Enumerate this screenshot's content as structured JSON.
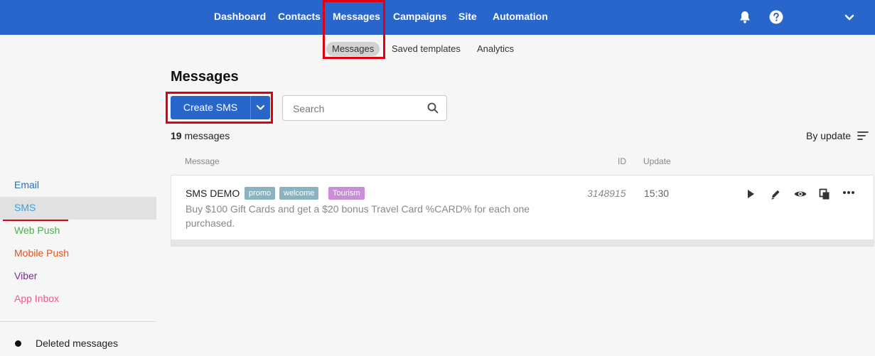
{
  "topnav": {
    "items": [
      {
        "label": "Dashboard"
      },
      {
        "label": "Contacts"
      },
      {
        "label": "Messages",
        "active": true
      },
      {
        "label": "Campaigns"
      },
      {
        "label": "Site"
      },
      {
        "label": "Automation"
      }
    ],
    "icons": [
      "bell-icon",
      "help-icon",
      "chevron-down-icon"
    ]
  },
  "subnav": {
    "items": [
      {
        "label": "Messages",
        "active": true
      },
      {
        "label": "Saved templates"
      },
      {
        "label": "Analytics"
      }
    ]
  },
  "sidebar": {
    "items": [
      {
        "label": "Email",
        "color": "#2a6fb0"
      },
      {
        "label": "SMS",
        "color": "#3aa0e0",
        "active": true
      },
      {
        "label": "Web Push",
        "color": "#4caf50"
      },
      {
        "label": "Mobile Push",
        "color": "#e0541f"
      },
      {
        "label": "Viber",
        "color": "#7b2c8f"
      },
      {
        "label": "App Inbox",
        "color": "#ec5a8c"
      }
    ],
    "deleted_label": "Deleted messages"
  },
  "main": {
    "title": "Messages",
    "create_label": "Create SMS",
    "search_placeholder": "Search",
    "count_number": "19",
    "count_suffix": "messages",
    "sort_label": "By update",
    "columns": {
      "message": "Message",
      "id": "ID",
      "update": "Update"
    },
    "messages": [
      {
        "name": "SMS DEMO",
        "tags": [
          {
            "label": "promo",
            "color": "#8ab3bf"
          },
          {
            "label": "welcome",
            "color": "#8ab3bf"
          },
          {
            "label": "Tourism",
            "color": "#c98fd6"
          }
        ],
        "body": "Buy $100 Gift Cards and get a $20 bonus Travel Card %CARD% for each one purchased.",
        "id": "3148915",
        "time": "15:30",
        "actions": [
          "play-icon",
          "edit-icon",
          "preview-icon",
          "copy-icon",
          "more-icon"
        ]
      }
    ]
  },
  "colors": {
    "brand": "#2866cc",
    "highlight": "#e00012"
  }
}
